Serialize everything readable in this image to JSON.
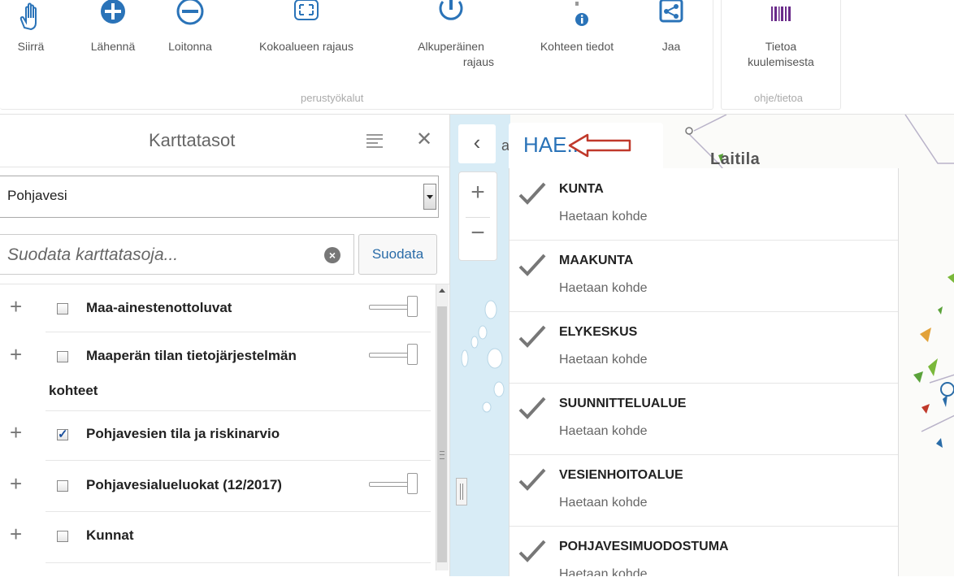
{
  "ribbon": {
    "tools": [
      {
        "name": "move-tool",
        "icon": "hand-icon",
        "label": "Siirrä"
      },
      {
        "name": "zoom-in-tool",
        "icon": "zoom-in-icon",
        "label": "Lähennä"
      },
      {
        "name": "zoom-out-tool",
        "icon": "zoom-out-icon",
        "label": "Loitonna"
      },
      {
        "name": "full-extent-tool",
        "icon": "expand-icon",
        "label": "Kokoalueen rajaus"
      },
      {
        "name": "original-extent-tool",
        "icon": "refresh-icon",
        "label_line1": "Alkuperäinen",
        "label_line2": "rajaus"
      },
      {
        "name": "feature-info-tool",
        "icon": "info-icon",
        "label": "Kohteen tiedot"
      },
      {
        "name": "share-tool",
        "icon": "share-icon",
        "label": "Jaa"
      }
    ],
    "main_group_label": "perustyökalut",
    "help_tool": {
      "icon": "barcode-icon",
      "label_line1": "Tietoa",
      "label_line2": "kuulemisesta"
    },
    "help_group_label": "ohje/tietoa"
  },
  "layers_panel": {
    "title": "Karttatasot",
    "select_value": "Pohjavesi",
    "filter_placeholder": "Suodata karttatasoja...",
    "filter_button": "Suodata",
    "layers": [
      {
        "label": "Maa-ainestenottoluvat",
        "checked": false,
        "has_slider": true
      },
      {
        "label": "Maaperän tilan tietojärjestelmän",
        "label_cont": "kohteet",
        "checked": false,
        "has_slider": true
      },
      {
        "label": "Pohjavesien tila ja riskinarvio",
        "checked": true,
        "has_slider": false
      },
      {
        "label": "Pohjavesialueluokat (12/2017)",
        "checked": false,
        "has_slider": true
      },
      {
        "label": "Kunnat",
        "checked": false,
        "has_slider": false
      }
    ]
  },
  "map": {
    "collapse_glyph": "‹",
    "zoom_in": "+",
    "zoom_out": "−",
    "place_label": "Laitila",
    "place_fragment": "a"
  },
  "search": {
    "query": "HAE..",
    "result_subtitle": "Haetaan kohde",
    "results": [
      "KUNTA",
      "MAAKUNTA",
      "ELYKESKUS",
      "SUUNNITTELUALUE",
      "VESIENHOITOALUE",
      "POHJAVESIMUODOSTUMA"
    ]
  },
  "colors": {
    "accent": "#2a73b8",
    "arrow": "#c0392b"
  }
}
